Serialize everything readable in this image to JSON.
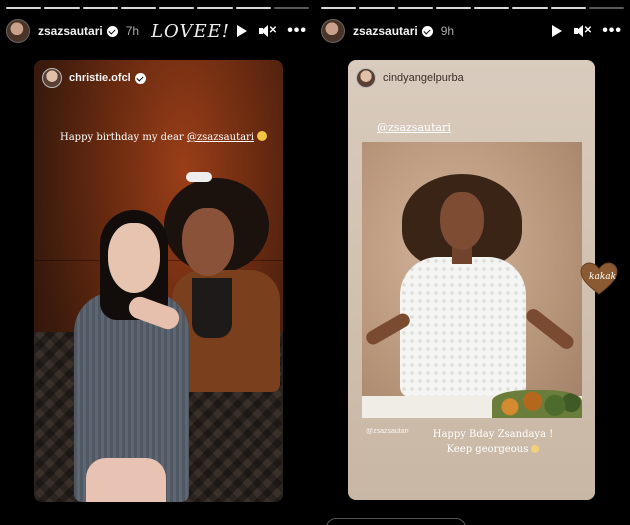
{
  "stories": [
    {
      "username": "zsazsautari",
      "time": "7h",
      "caption": "LOVEE!",
      "segments_total": 8,
      "segments_seen": 8,
      "shared_post": {
        "username": "christie.ofcl",
        "text_prefix": "Happy birthday my dear ",
        "mention": "@zsazsautari"
      }
    },
    {
      "username": "zsazsautari",
      "time": "9h",
      "segments_total": 8,
      "segments_seen": 8,
      "shared_post": {
        "username": "cindyangelpurba",
        "mention": "@zsazsautari",
        "photo_tag": "@zsazsautari",
        "wish_line1": "Happy Bday Zsandaya !",
        "wish_line2": "Keep georgeous"
      },
      "sticker_text": "kakak"
    }
  ],
  "colors": {
    "background": "#000000",
    "card_left_wall": "#6b2b11",
    "card_right_bg": "#d9cbbd",
    "heart_sticker": "#8a5a32"
  },
  "icons": [
    "verified-badge-icon",
    "play-icon",
    "mute-icon",
    "more-icon",
    "heart-icon"
  ]
}
